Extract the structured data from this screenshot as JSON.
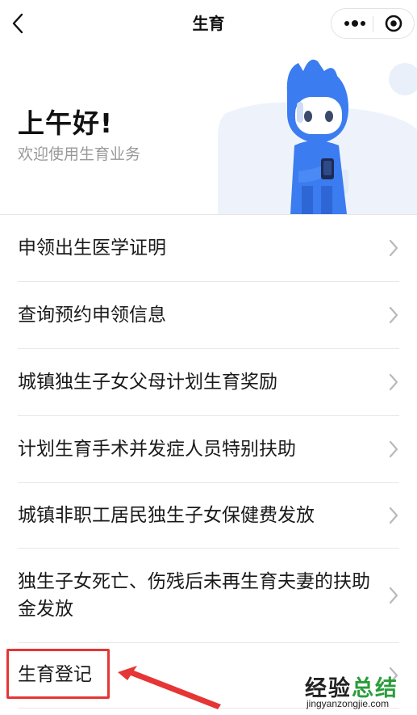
{
  "navbar": {
    "title": "生育"
  },
  "hero": {
    "greeting": "上午好!",
    "subtitle": "欢迎使用生育业务"
  },
  "menu": {
    "items": [
      {
        "label": "申领出生医学证明"
      },
      {
        "label": "查询预约申领信息"
      },
      {
        "label": "城镇独生子女父母计划生育奖励"
      },
      {
        "label": "计划生育手术并发症人员特别扶助"
      },
      {
        "label": "城镇非职工居民独生子女保健费发放"
      },
      {
        "label": "独生子女死亡、伤残后未再生育夫妻的扶助金发放"
      },
      {
        "label": "生育登记"
      }
    ]
  },
  "watermark": {
    "part1": "经验",
    "part2": "总结",
    "url": "jingyanzongjie.com"
  },
  "colors": {
    "accent_blue": "#3b7cf0",
    "highlight_red": "#e53535",
    "watermark_green": "#2a9d3a"
  }
}
